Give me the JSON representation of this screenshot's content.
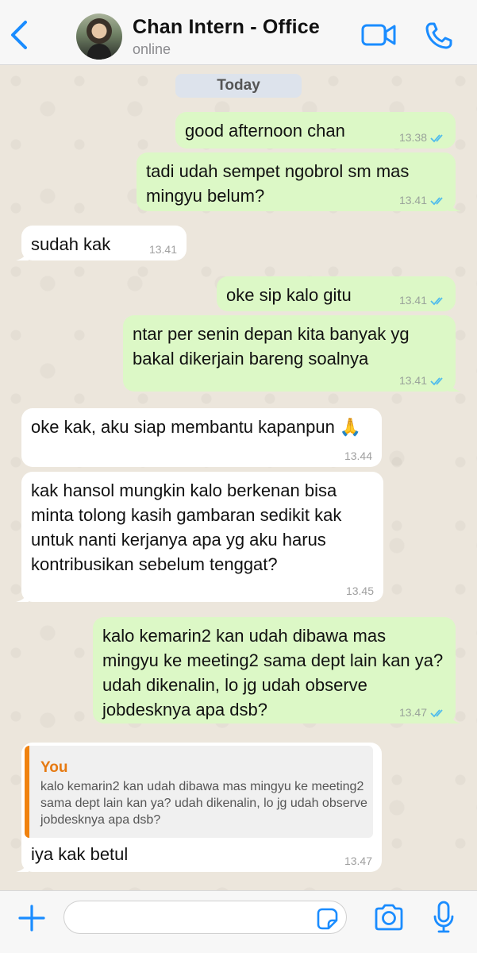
{
  "header": {
    "back_icon": "chevron-left-icon",
    "contact_name": "Chan Intern - Office",
    "status": "online",
    "video_icon": "video-camera-icon",
    "phone_icon": "phone-icon"
  },
  "chat": {
    "date_label": "Today",
    "messages": [
      {
        "direction": "out",
        "text": "good afternoon chan",
        "time": "13.38",
        "read": true
      },
      {
        "direction": "out",
        "text": "tadi udah sempet ngobrol sm mas mingyu belum?",
        "time": "13.41",
        "read": true
      },
      {
        "direction": "in",
        "text": "sudah kak",
        "time": "13.41"
      },
      {
        "direction": "out",
        "text": "oke sip kalo gitu",
        "time": "13.41",
        "read": true
      },
      {
        "direction": "out",
        "text": "ntar per senin depan kita banyak yg bakal dikerjain bareng soalnya",
        "time": "13.41",
        "read": true
      },
      {
        "direction": "in",
        "text": "oke kak, aku siap membantu kapanpun 🙏",
        "time": "13.44"
      },
      {
        "direction": "in",
        "text": "kak hansol mungkin kalo berkenan bisa minta tolong kasih gambaran sedikit kak untuk nanti kerjanya apa yg aku harus kontribusikan sebelum tenggat?",
        "time": "13.45"
      },
      {
        "direction": "out",
        "text": "kalo kemarin2 kan udah dibawa mas mingyu ke meeting2 sama dept lain kan ya? udah dikenalin, lo jg udah observe jobdesknya apa dsb?",
        "time": "13.47",
        "read": true
      },
      {
        "direction": "in",
        "quote": {
          "author": "You",
          "text": "kalo kemarin2 kan udah dibawa mas mingyu ke meeting2 sama dept lain kan ya? udah dikenalin, lo jg udah observe jobdesknya apa dsb?"
        },
        "text": "iya kak betul",
        "time": "13.47"
      }
    ]
  },
  "input_bar": {
    "plus_icon": "plus-icon",
    "message_value": "",
    "sticker_icon": "sticker-icon",
    "camera_icon": "camera-icon",
    "mic_icon": "microphone-icon"
  },
  "colors": {
    "accent": "#1a8cff",
    "outgoing_bubble": "#dcf8c6",
    "incoming_bubble": "#ffffff",
    "read_ticks": "#53bdeb",
    "quote_author": "#e67a12"
  }
}
